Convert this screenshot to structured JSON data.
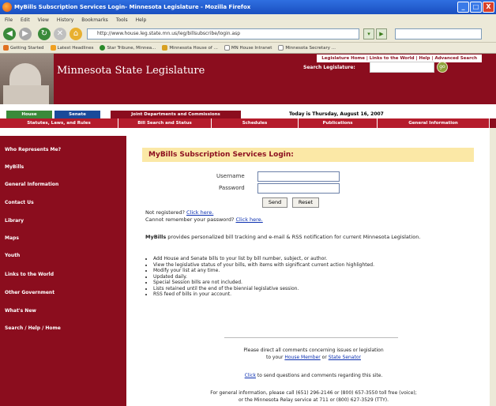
{
  "window": {
    "title": "MyBills Subscription Services Login- Minnesota Legislature - Mozilla Firefox",
    "controls": [
      "_",
      "□",
      "X"
    ]
  },
  "menu": [
    "File",
    "Edit",
    "View",
    "History",
    "Bookmarks",
    "Tools",
    "Help"
  ],
  "url": "http://www.house.leg.state.mn.us/leg/billsubscribe/login.asp",
  "bookmarks": [
    "Getting Started",
    "Latest Headlines",
    "Star Tribune, Minnea...",
    "Minnesota House of ...",
    "MN House Intranet",
    "Minnesota Secretary ..."
  ],
  "site": {
    "title": "Minnesota State Legislature",
    "top_links": "Legislature Home | Links to the World | Help | Advanced Search",
    "search_label": "Search Legislature:",
    "go": "go",
    "tabs_row1": [
      "House",
      "Senate",
      "Joint Departments and Commissions"
    ],
    "date": "Today is Thursday, August 16, 2007",
    "tabs_row2": [
      "Statutes, Laws, and Rules",
      "Bill Search and Status",
      "Schedules",
      "Publications",
      "General Information"
    ]
  },
  "leftnav": [
    "Who Represents Me?",
    "MyBills",
    "General Information",
    "Contact Us",
    "Library",
    "Maps",
    "Youth",
    "Links to the World",
    "Other Government",
    "What's New",
    "Search / Help / Home"
  ],
  "login": {
    "heading": "MyBills Subscription Services Login:",
    "username_label": "Username",
    "password_label": "Password",
    "send": "Send",
    "reset": "Reset",
    "not_registered": "Not registered?",
    "click_here": "Click here.",
    "forgot": "Cannot remember your password?",
    "intro_bold": "MyBills",
    "intro": "provides personalized bill tracking and e-mail & RSS notification for current Minnesota Legislation.",
    "bullets": [
      "Add House and Senate bills to your list by bill number, subject, or author.",
      "View the legislative status of your bills, with items with significant current action highlighted.",
      "Modify your list at any time.",
      "Updated daily.",
      "Special Session bills are not included.",
      "Lists retained until the end of the biennial legislative session.",
      "RSS feed of bills in your account."
    ],
    "footer1": "Please direct all comments concerning issues or legislation",
    "footer2a": "to your",
    "house_member": "House Member",
    "or": "or",
    "state_senator": "State Senator",
    "click": "Click",
    "footer3": "to send questions and comments regarding this site.",
    "footer4": "For general information, please call (651) 296-2146 or (800) 657-3550 toll free (voice);",
    "footer5": "or the Minnesota Relay service at 711 or (800) 627-3529 (TTY)."
  }
}
